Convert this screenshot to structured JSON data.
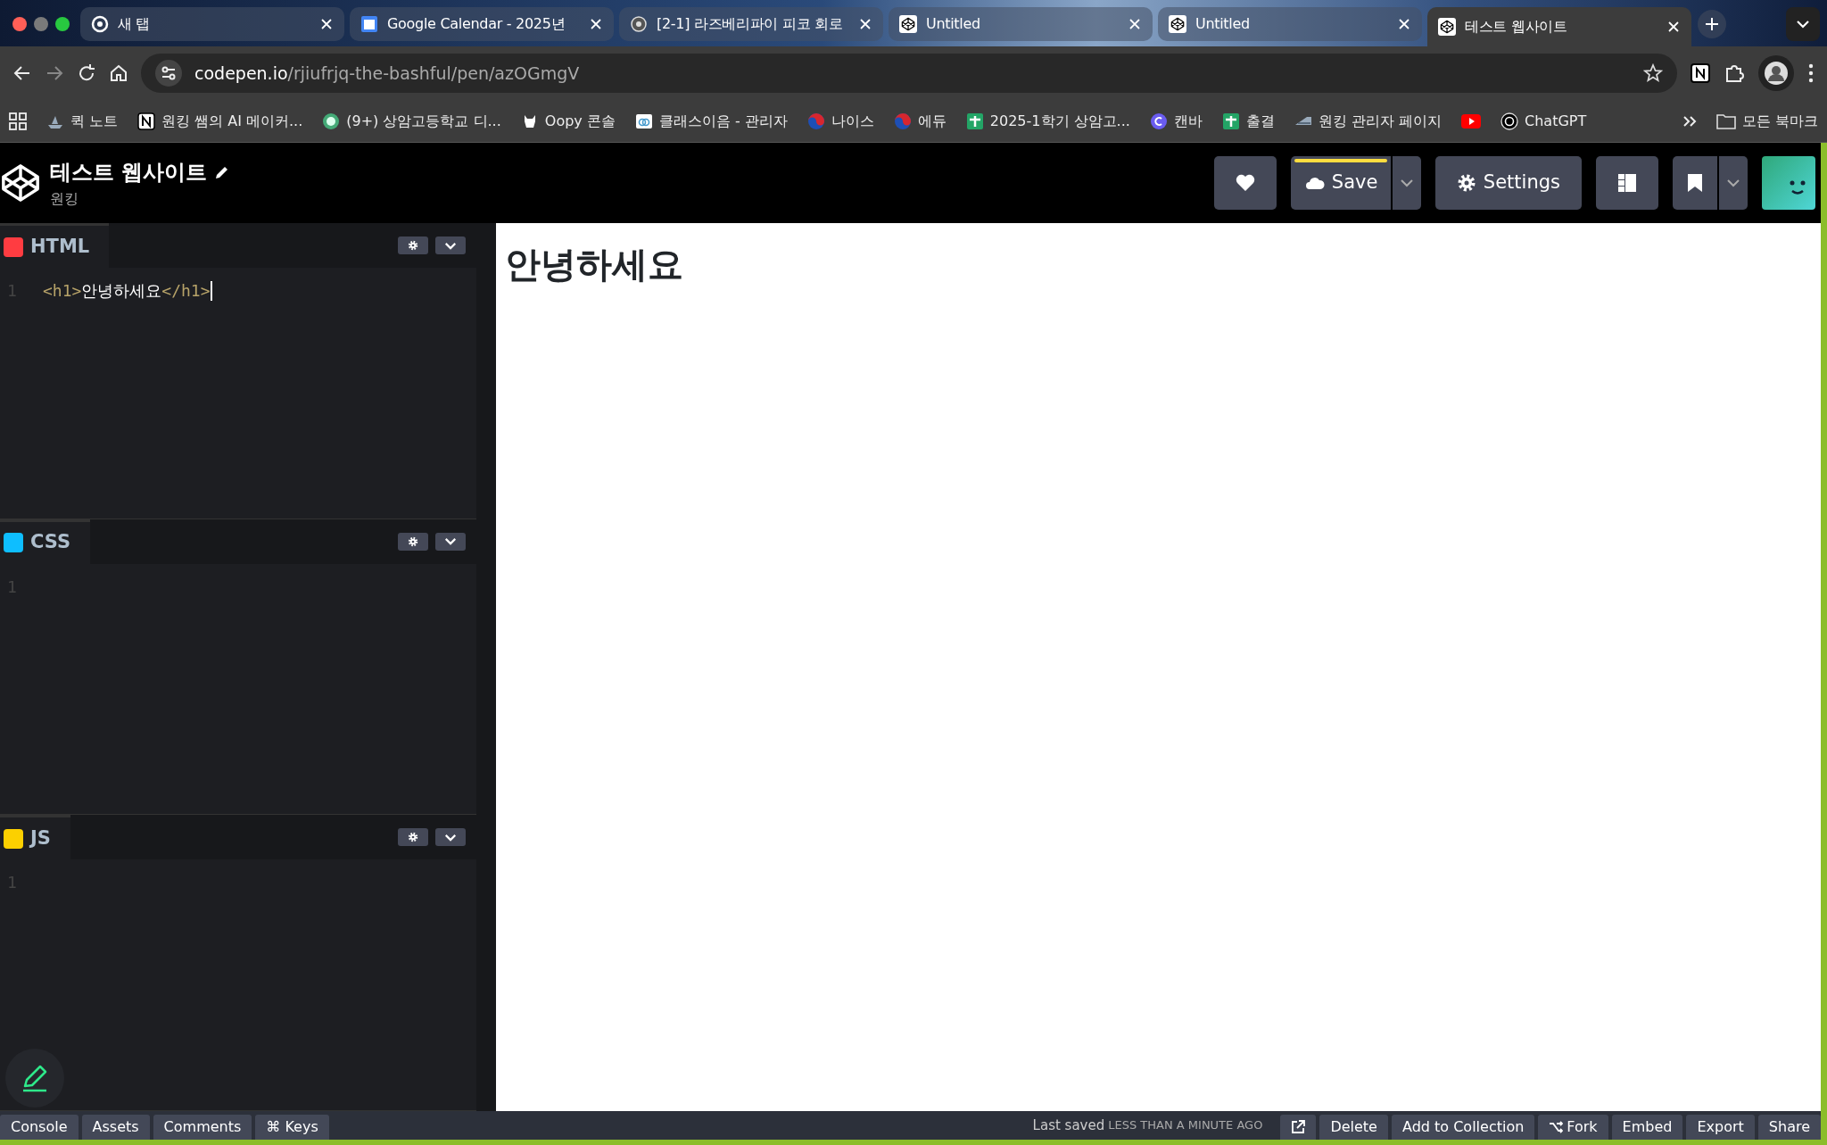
{
  "browser": {
    "tabs": [
      {
        "title": "새 탭",
        "selected": false
      },
      {
        "title": "Google Calendar - 2025년",
        "selected": false
      },
      {
        "title": "[2-1] 라즈베리파이 피코 회로",
        "selected": false
      },
      {
        "title": "Untitled",
        "selected": false
      },
      {
        "title": "Untitled",
        "selected": false
      },
      {
        "title": "테스트 웹사이트",
        "selected": true
      }
    ],
    "address": {
      "host": "codepen.io",
      "path": "/rjiufrjq-the-bashful/pen/azOGmgV"
    },
    "bookmarks": [
      "퀵 노트",
      "원킹 쌤의 AI 메이커...",
      "(9+) 상암고등학교 디...",
      "Oopy 콘솔",
      "클래스이음 - 관리자",
      "나이스",
      "에듀",
      "2025-1학기 상암고...",
      "캔바",
      "출결",
      "원킹 관리자 페이지",
      "ChatGPT"
    ],
    "all_bookmarks": "모든 북마크"
  },
  "pen": {
    "title": "테스트 웹사이트",
    "author": "원킹",
    "save": {
      "label": "Save",
      "unsaved_changes": true
    },
    "settings": "Settings"
  },
  "editors": [
    {
      "name": "HTML",
      "color": "#ff3c41",
      "lines": [
        {
          "number": "1",
          "tokens": [
            {
              "kind": "tag",
              "text": "<h1>"
            },
            {
              "kind": "text",
              "text": "안녕하세요"
            },
            {
              "kind": "tag",
              "text": "</h1>"
            }
          ]
        }
      ]
    },
    {
      "name": "CSS",
      "color": "#0ebeff",
      "lines": [
        {
          "number": "1"
        }
      ]
    },
    {
      "name": "JS",
      "color": "#fcd000",
      "lines": [
        {
          "number": "1"
        }
      ]
    }
  ],
  "preview": {
    "heading": "안녕하세요"
  },
  "footer": {
    "left": [
      "Console",
      "Assets",
      "Comments",
      "⌘ Keys"
    ],
    "saved_label": "Last saved",
    "saved_time": "LESS THAN A MINUTE AGO",
    "right": [
      {
        "kind": "icon"
      },
      {
        "kind": "text",
        "label": "Delete"
      },
      {
        "kind": "text",
        "label": "Add to Collection"
      },
      {
        "kind": "fork",
        "label": "Fork"
      },
      {
        "kind": "text",
        "label": "Embed"
      },
      {
        "kind": "text",
        "label": "Export"
      },
      {
        "kind": "text",
        "label": "Share"
      }
    ]
  }
}
